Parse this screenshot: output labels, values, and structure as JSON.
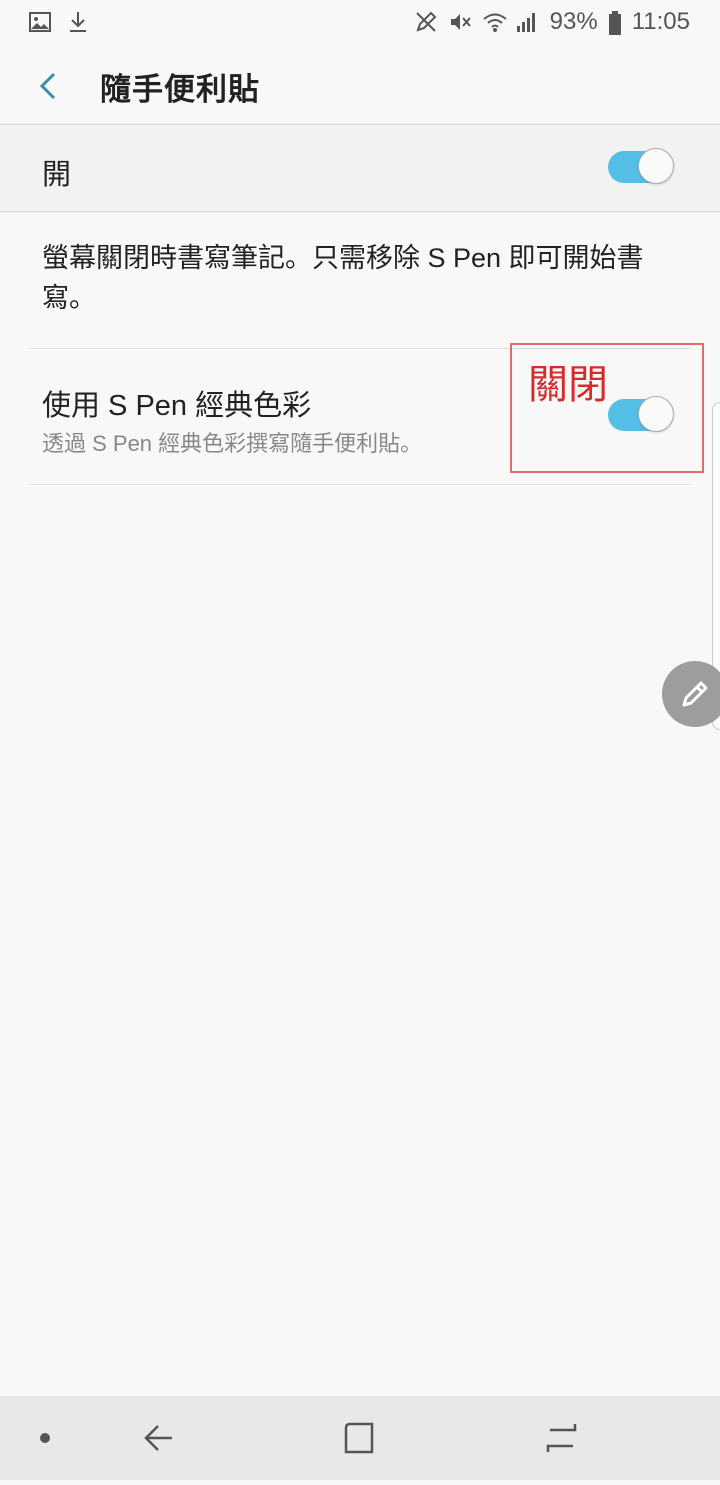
{
  "status_bar": {
    "icons_left": [
      "image-icon",
      "download-icon"
    ],
    "icons_right": [
      "pen-icon",
      "mute-icon",
      "wifi-icon",
      "signal-icon"
    ],
    "battery": "93%",
    "time": "11:05"
  },
  "header": {
    "title": "隨手便利貼"
  },
  "master": {
    "label": "開",
    "enabled": true
  },
  "description": "螢幕關閉時書寫筆記。只需移除 S Pen 即可開始書寫。",
  "spen_setting": {
    "title": "使用 S Pen 經典色彩",
    "subtitle": "透過 S Pen 經典色彩撰寫隨手便利貼。",
    "enabled": true
  },
  "annotation": {
    "text": "關閉",
    "color": "#d72b2b"
  },
  "colors": {
    "accent": "#54bfe6",
    "back_arrow": "#3a8fa8"
  }
}
